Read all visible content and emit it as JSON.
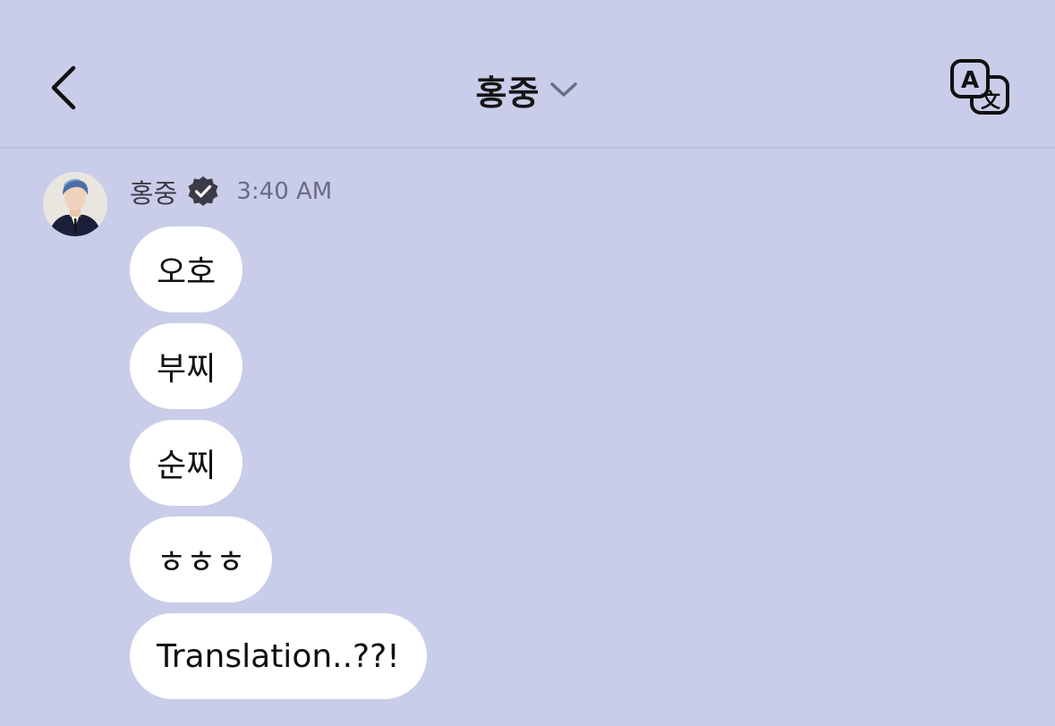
{
  "header": {
    "title": "홍중",
    "back_icon": "chevron-left-icon",
    "dropdown_icon": "chevron-down-icon",
    "translate_icon": "translate-icon",
    "translate_glyph_a": "A",
    "translate_glyph_b": "文"
  },
  "message_group": {
    "sender": "홍중",
    "verified_icon": "verified-badge-icon",
    "time": "3:40 AM",
    "messages": [
      {
        "text": "오호"
      },
      {
        "text": "부찌"
      },
      {
        "text": "순찌"
      },
      {
        "text": "ㅎㅎㅎ"
      },
      {
        "text": "Translation..??!"
      }
    ]
  },
  "colors": {
    "background": "#c9cde9",
    "bubble": "#ffffff",
    "divider": "#bcc0dd",
    "verified_badge": "#3a3b47"
  }
}
